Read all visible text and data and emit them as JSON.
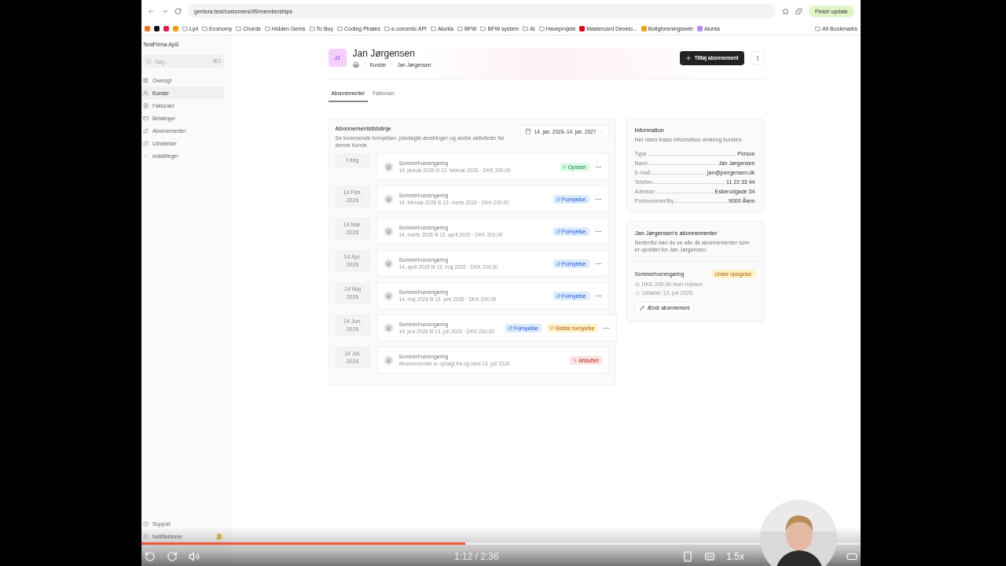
{
  "browser": {
    "url": "gentura.test/customers/95/memberships",
    "update_button": "Finish update",
    "bookmarks": [
      {
        "kind": "site",
        "color": "#f97316"
      },
      {
        "kind": "site",
        "color": "#111111"
      },
      {
        "kind": "site",
        "color": "#e11d48"
      },
      {
        "kind": "site",
        "color": "#f59e0b"
      },
      {
        "kind": "folder",
        "label": "Lyd"
      },
      {
        "kind": "folder",
        "label": "Economy"
      },
      {
        "kind": "folder",
        "label": "Chords"
      },
      {
        "kind": "folder",
        "label": "Hidden Gems"
      },
      {
        "kind": "folder",
        "label": "To Buy"
      },
      {
        "kind": "folder",
        "label": "Coding Pirates"
      },
      {
        "kind": "folder",
        "label": "e-conomic API"
      },
      {
        "kind": "folder",
        "label": "Alunta"
      },
      {
        "kind": "folder",
        "label": "BFW"
      },
      {
        "kind": "folder",
        "label": "BFW system"
      },
      {
        "kind": "folder",
        "label": "AI"
      },
      {
        "kind": "folder",
        "label": "Haveprojekt"
      },
      {
        "kind": "site",
        "label": "Mastercard Develo...",
        "color": "#eb001b"
      },
      {
        "kind": "site",
        "label": "Boligforeningsweb",
        "color": "#f59e0b"
      },
      {
        "kind": "site",
        "label": "Alunta",
        "color": "#c084fc"
      }
    ],
    "all_bookmarks": "All Bookmarks"
  },
  "sidebar": {
    "company": "TestFirma ApS",
    "search": {
      "placeholder": "Søg...",
      "shortcut": "⌘S"
    },
    "items": [
      {
        "label": "Oversigt",
        "selected": false
      },
      {
        "label": "Kunder",
        "selected": true
      },
      {
        "label": "Fakturaer",
        "selected": false
      },
      {
        "label": "Betalinger",
        "selected": false
      },
      {
        "label": "Abonnementer",
        "selected": false
      },
      {
        "label": "Udvidelser",
        "selected": false
      },
      {
        "label": "Indstillinger",
        "selected": false
      }
    ],
    "footer_items": [
      {
        "label": "Support"
      },
      {
        "label": "Notifikationer",
        "badge": "2"
      }
    ]
  },
  "header": {
    "initials": "JJ",
    "name": "Jan Jørgensen",
    "breadcrumbs": [
      "Kunder",
      "Jan Jørgensen"
    ],
    "add_button": "Tilføj abonnement"
  },
  "tabs": [
    {
      "label": "Abonnementer",
      "selected": true
    },
    {
      "label": "Fakturaer",
      "selected": false
    }
  ],
  "timeline": {
    "title": "Abonnementstidslinje",
    "subtitle": "Se kommende fornyelser, planlagte ændringer og andre aktiviteter for denne kunde.",
    "date_range": "14. jan. 2026–14. jan. 2027",
    "events": [
      {
        "date": "I dag",
        "title": "Sommerhusrengøring",
        "detail": "14. januar 2026 til 13. februar 2026 · DKK 200,00",
        "badges": [
          {
            "kind": "start",
            "label": "Opstart"
          }
        ]
      },
      {
        "date": "14 Feb. 2026",
        "title": "Sommerhusrengøring",
        "detail": "14. februar 2026 til 13. marts 2026 · DKK 200,00",
        "badges": [
          {
            "kind": "renewal",
            "label": "Fornyelse"
          }
        ]
      },
      {
        "date": "14 Mar. 2026",
        "title": "Sommerhusrengøring",
        "detail": "14. marts 2026 til 13. april 2026 · DKK 200,00",
        "badges": [
          {
            "kind": "renewal",
            "label": "Fornyelse"
          }
        ]
      },
      {
        "date": "14 Apr. 2026",
        "title": "Sommerhusrengøring",
        "detail": "14. april 2026 til 13. maj 2026 · DKK 200,00",
        "badges": [
          {
            "kind": "renewal",
            "label": "Fornyelse"
          }
        ]
      },
      {
        "date": "14 Maj 2026",
        "title": "Sommerhusrengøring",
        "detail": "14. maj 2026 til 13. juni 2026 · DKK 200,00",
        "badges": [
          {
            "kind": "renewal",
            "label": "Fornyelse"
          }
        ]
      },
      {
        "date": "14 Jun. 2026",
        "title": "Sommerhusrengøring",
        "detail": "14. juni 2026 til 13. juli 2026 · DKK 200,00",
        "badges": [
          {
            "kind": "renewal",
            "label": "Fornyelse"
          },
          {
            "kind": "last",
            "label": "Sidste fornyelse"
          }
        ]
      },
      {
        "date": "14 Jul. 2026",
        "title": "Sommerhusrengøring",
        "detail": "Abonnementet er opsagt fra og med 14. juli 2026",
        "badges": [
          {
            "kind": "ended",
            "label": "Afsluttet"
          }
        ]
      }
    ]
  },
  "info": {
    "title": "Information",
    "subtitle": "Her vises basis information omkring kunden.",
    "fields": [
      {
        "label": "Type",
        "value": "Person"
      },
      {
        "label": "Navn",
        "value": "Jan Jørgensen"
      },
      {
        "label": "E-mail",
        "value": "jan@joergensen.dk"
      },
      {
        "label": "Telefon",
        "value": "11 22 33 44"
      },
      {
        "label": "Adresse",
        "value": "Eskerodgade 54"
      },
      {
        "label": "Postnummer/By",
        "value": "9000 Ålem"
      }
    ]
  },
  "subscriptions": {
    "title": "Jan Jørgensen's abonnementer",
    "subtitle": "Nedenfor kan du se alle de abonnementer som er oprettet for Jan Jørgensen.",
    "items": [
      {
        "name": "Sommerhusrengøring",
        "status": "Under opsigelse",
        "price": "DKK 200,00 hver måned",
        "expires": "Udløber 13. juli 2026",
        "edit_button": "Ændr abonnement"
      }
    ]
  },
  "player": {
    "progress": {
      "level": 0.45
    },
    "time": "1:12 / 2:36",
    "speed": "1.5x"
  }
}
